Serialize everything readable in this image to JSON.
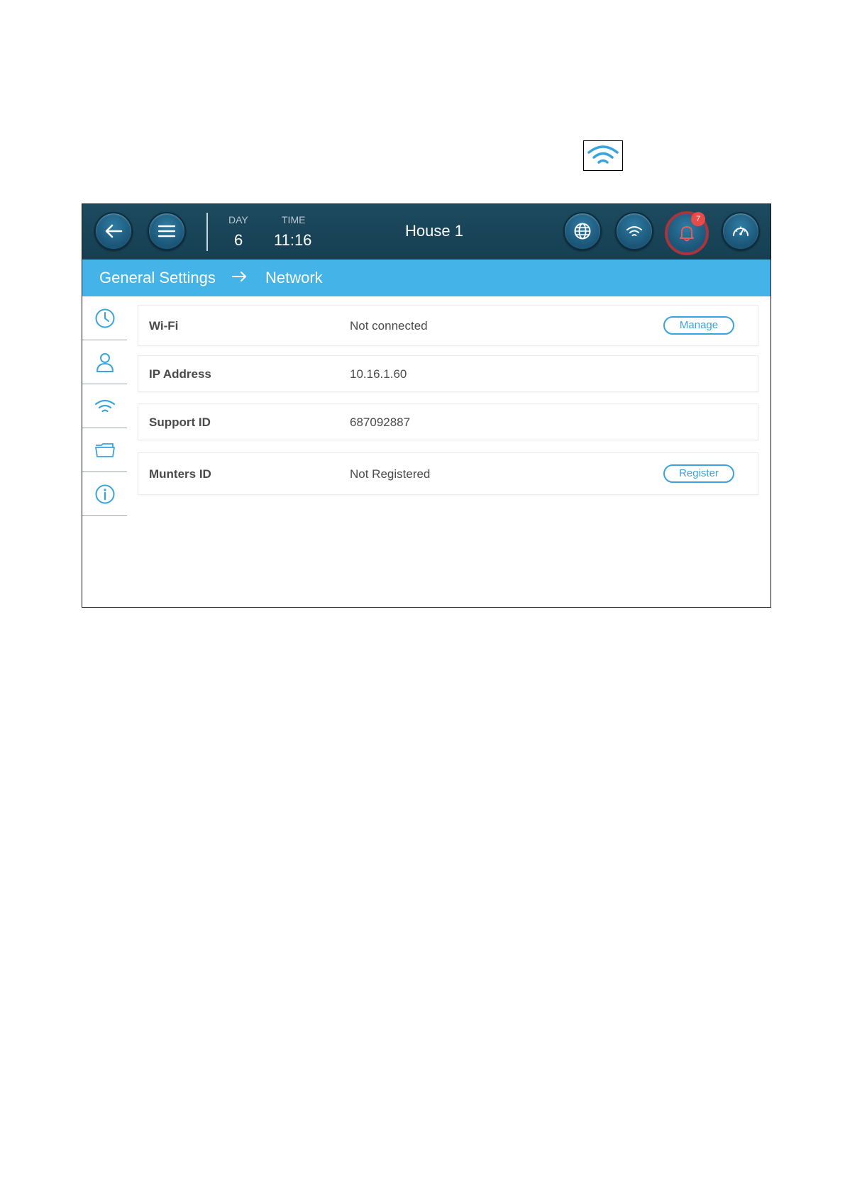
{
  "legend": {
    "icon": "wifi-icon",
    "color": "#3aa3dc"
  },
  "header": {
    "day_label": "DAY",
    "day_value": "6",
    "time_label": "TIME",
    "time_value": "11:16",
    "house_name": "House 1",
    "alarm_count": "7",
    "icons": [
      "back-arrow-icon",
      "menu-icon",
      "globe-icon",
      "wifi-icon",
      "bell-icon",
      "gauge-icon"
    ]
  },
  "breadcrumb": {
    "parent": "General Settings",
    "current": "Network"
  },
  "sidebar": {
    "items": [
      "clock-icon",
      "user-icon",
      "wifi-icon",
      "folder-icon",
      "info-icon"
    ],
    "active": "wifi-icon"
  },
  "network": {
    "wifi": {
      "label": "Wi-Fi",
      "value": "Not connected",
      "button": "Manage"
    },
    "ip": {
      "label": "IP Address",
      "value": "10.16.1.60"
    },
    "support": {
      "label": "Support ID",
      "value": "687092887"
    },
    "munters": {
      "label": "Munters ID",
      "value": "Not Registered",
      "button": "Register"
    }
  },
  "colors": {
    "header_bg": "#1d4a5f",
    "breadcrumb_bg": "#43b3e8",
    "accent": "#3aa3dc",
    "alarm_ring": "#a8343c",
    "badge": "#e94b4b"
  }
}
